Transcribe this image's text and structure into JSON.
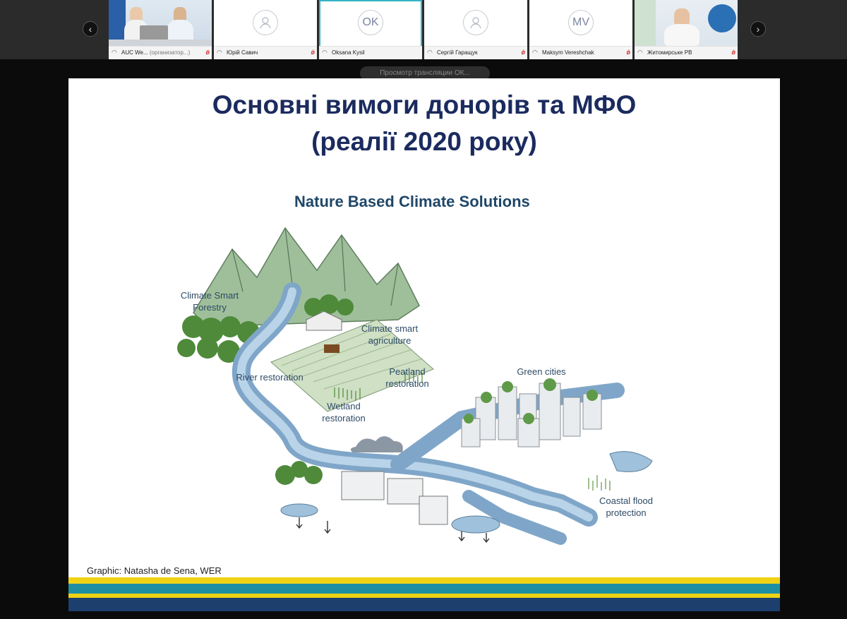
{
  "participants": [
    {
      "name": "AUC We...",
      "role": "(организатор...)",
      "type": "video"
    },
    {
      "name": "Юрій Савич",
      "type": "placeholder"
    },
    {
      "name": "Oksana Kysil",
      "type": "initials",
      "initials": "OK",
      "active": true
    },
    {
      "name": "Сергій Гаращук",
      "type": "placeholder"
    },
    {
      "name": "Maksym Vereshchak",
      "type": "initials",
      "initials": "MV"
    },
    {
      "name": "Житомирське РВ",
      "type": "video"
    }
  ],
  "tooltip": "Просмотр трансляции ОК...",
  "slide": {
    "title_line1": "Основні вимоги донорів та МФО",
    "title_line2": "(реалії 2020 року)",
    "graphic_title": "Nature Based Climate Solutions",
    "labels": {
      "forestry": "Climate Smart\nForestry",
      "agriculture": "Climate smart\nagriculture",
      "river": "River restoration",
      "peatland": "Peatland\nrestoration",
      "green_cities": "Green cities",
      "wetland": "Wetland\nrestoration",
      "coastal": "Coastal flood\nprotection"
    },
    "credit": "Graphic: Natasha de Sena, WER"
  },
  "colors": {
    "title": "#1b2b5e",
    "band_yellow": "#f0d214",
    "band_teal": "#1e8fa3",
    "band_navy": "#1c3f6e",
    "active_border": "#34b3c6"
  },
  "icons": {
    "prev": "chevron-left-icon",
    "next": "chevron-right-icon",
    "mic": "headset-icon",
    "muted": "mic-muted-icon"
  }
}
